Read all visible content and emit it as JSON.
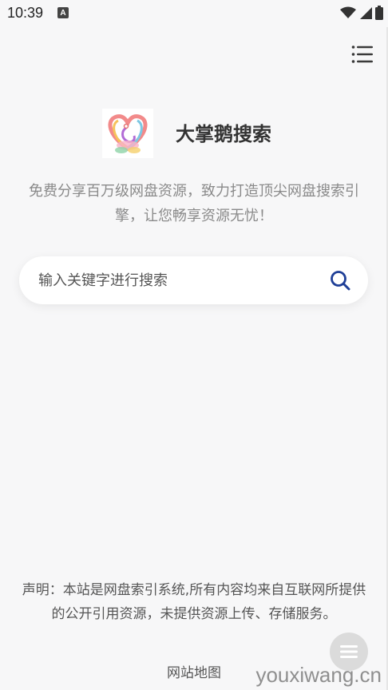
{
  "status_bar": {
    "time": "10:39",
    "notification_letter": "A",
    "icons": [
      "wifi-icon",
      "signal-icon",
      "battery-icon"
    ]
  },
  "header": {
    "menu_icon": "hamburger-menu-icon"
  },
  "brand": {
    "logo_icon": "swan-heart-logo",
    "title": "大掌鹅搜索",
    "tagline": "免费分享百万级网盘资源，致力打造顶尖网盘搜索引擎，让您畅享资源无忧！"
  },
  "search": {
    "placeholder": "输入关键字进行搜索",
    "button_icon": "search-icon",
    "accent_color": "#1f3f97"
  },
  "footer": {
    "disclaimer": "声明：本站是网盘索引系统,所有内容均来自互联网所提供的公开引用资源，未提供资源上传、存储服务。",
    "sitemap_label": "网站地图",
    "float_button_icon": "list-icon"
  },
  "watermark": "youxiwang.cn"
}
